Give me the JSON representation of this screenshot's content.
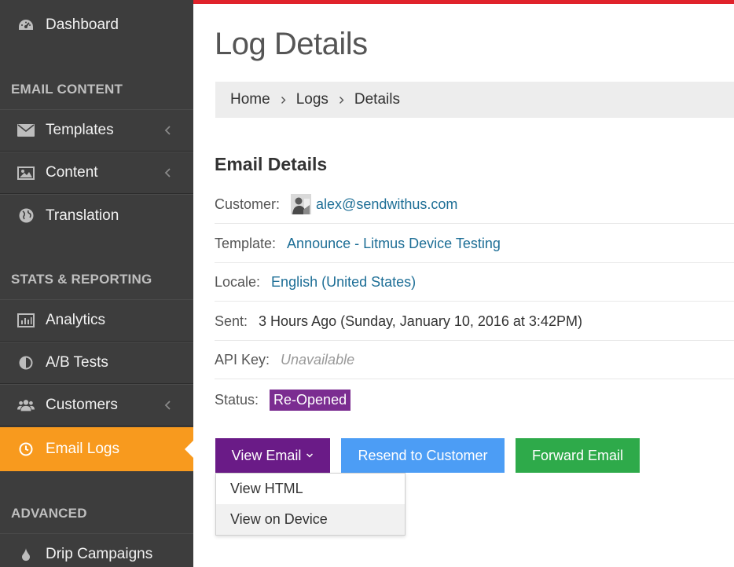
{
  "sidebar": {
    "items": {
      "dashboard": {
        "label": "Dashboard",
        "icon": "dashboard-icon"
      },
      "templates": {
        "label": "Templates",
        "icon": "envelope-icon"
      },
      "content": {
        "label": "Content",
        "icon": "image-icon"
      },
      "translation": {
        "label": "Translation",
        "icon": "globe-icon"
      },
      "analytics": {
        "label": "Analytics",
        "icon": "bar-chart-icon"
      },
      "ab_tests": {
        "label": "A/B Tests",
        "icon": "half-circle-icon"
      },
      "customers": {
        "label": "Customers",
        "icon": "users-icon"
      },
      "email_logs": {
        "label": "Email Logs",
        "icon": "clock-icon"
      },
      "drip_campaigns": {
        "label": "Drip Campaigns",
        "icon": "drop-icon"
      }
    },
    "sections": {
      "email_content": "EMAIL CONTENT",
      "stats_reporting": "STATS & REPORTING",
      "advanced": "ADVANCED"
    }
  },
  "page": {
    "title": "Log Details",
    "breadcrumb": [
      "Home",
      "Logs",
      "Details"
    ],
    "section_title": "Email Details"
  },
  "details": {
    "customer": {
      "label": "Customer:",
      "value": "alex@sendwithus.com"
    },
    "template": {
      "label": "Template:",
      "value": "Announce - Litmus Device Testing"
    },
    "locale": {
      "label": "Locale:",
      "value": "English (United States)"
    },
    "sent": {
      "label": "Sent:",
      "value": "3 Hours Ago (Sunday, January 10, 2016 at 3:42PM)"
    },
    "api_key": {
      "label": "API Key:",
      "value": "Unavailable"
    },
    "status": {
      "label": "Status:",
      "value": "Re-Opened"
    }
  },
  "actions": {
    "view_email": "View Email",
    "resend": "Resend to Customer",
    "forward": "Forward Email",
    "dropdown": [
      "View HTML",
      "View on Device"
    ]
  },
  "colors": {
    "sidebar_bg": "#3d3d3d",
    "active_item": "#f89a1e",
    "top_accent": "#e0232b",
    "status_badge": "#7b2d91",
    "view_button": "#6a1b87",
    "resend_button": "#4c9df5",
    "forward_button": "#2eaa4a",
    "link": "#1d6e96"
  }
}
